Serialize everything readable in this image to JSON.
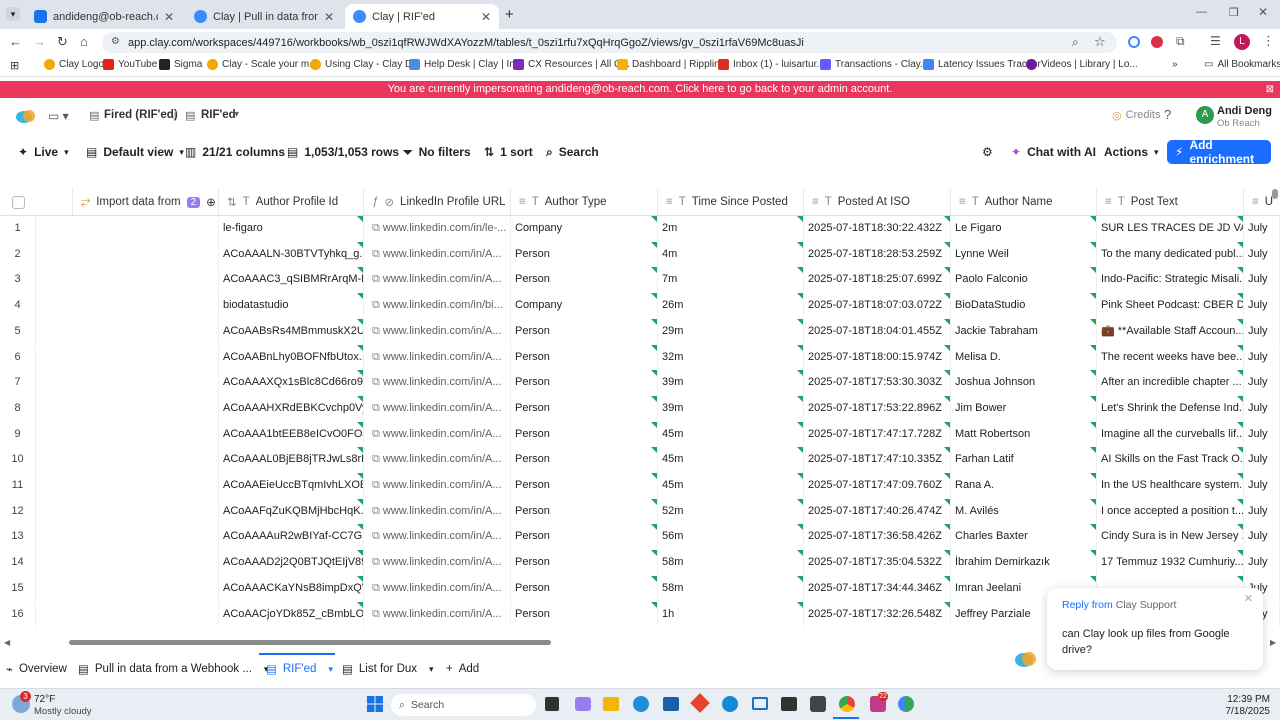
{
  "browser": {
    "tabs": [
      {
        "title": "andideng@ob-reach.com | Inb",
        "color": "#1a73e8"
      },
      {
        "title": "Clay | Pull in data from a Webh",
        "color": "#3d8bfd"
      },
      {
        "title": "Clay | RIF'ed",
        "color": "#3d8bfd"
      }
    ],
    "url": "app.clay.com/workspaces/449716/workbooks/wb_0szi1qfRWJWdXAYozzM/tables/t_0szi1rfu7xQqHrqGgoZ/views/gv_0szi1rfaV69Mc8uasJi",
    "bookmarks": [
      {
        "label": "Clay Logo",
        "color": "#f2a900"
      },
      {
        "label": "YouTube",
        "color": "#e62117"
      },
      {
        "label": "Sigma",
        "color": "#222222"
      },
      {
        "label": "Clay - Scale your m...",
        "color": "#f2a900"
      },
      {
        "label": "Using Clay - Clay D...",
        "color": "#f2a900"
      },
      {
        "label": "Help Desk | Clay | In...",
        "color": "#4a90d9"
      },
      {
        "label": "CX Resources | All Q...",
        "color": "#7b2cbf"
      },
      {
        "label": "Dashboard | Rippling",
        "color": "#f4b400"
      },
      {
        "label": "Inbox (1) - luisartur...",
        "color": "#d93025"
      },
      {
        "label": "Transactions - Clay...",
        "color": "#635bff"
      },
      {
        "label": "Latency Issues Tracker",
        "color": "#4285f4"
      },
      {
        "label": "Videos | Library | Lo...",
        "color": "#6a1b9a"
      }
    ],
    "all_bookmarks": "All Bookmarks",
    "profile_initial": "L"
  },
  "banner": "You are currently impersonating andideng@ob-reach.com. Click here to go back to your admin account.",
  "app": {
    "breadcrumb_folder": "Fired (RIF'ed)",
    "breadcrumb_table": "RIF'ed",
    "credits": "Credits",
    "user_name": "Andi Deng",
    "user_org": "Ob Reach",
    "user_initial": "A"
  },
  "toolbar": {
    "live": "Live",
    "view": "Default view",
    "columns": "21/21 columns",
    "rows": "1,053/1,053 rows",
    "filters": "No filters",
    "sort": "1 sort",
    "search": "Search",
    "chat": "Chat with AI",
    "actions": "Actions",
    "add_enrichment": "Add enrichment"
  },
  "columns": [
    {
      "label": "Import data from",
      "badge": "2"
    },
    {
      "label": "Author Profile Id"
    },
    {
      "label": "LinkedIn Profile URL"
    },
    {
      "label": "Author Type"
    },
    {
      "label": "Time Since Posted"
    },
    {
      "label": "Posted At ISO"
    },
    {
      "label": "Author Name"
    },
    {
      "label": "Post Text"
    },
    {
      "label": "U"
    }
  ],
  "rows": [
    {
      "n": "1",
      "id": "le-figaro",
      "url": "www.linkedin.com/in/le-...",
      "type": "Company",
      "since": "2m",
      "iso": "2025-07-18T18:30:22.432Z",
      "name": "Le Figaro",
      "text": "SUR LES TRACES DE JD VAN...",
      "u": "July"
    },
    {
      "n": "2",
      "id": "ACoAAALN-30BTVTyhkq_g...",
      "url": "www.linkedin.com/in/A...",
      "type": "Person",
      "since": "4m",
      "iso": "2025-07-18T18:28:53.259Z",
      "name": "Lynne Weil",
      "text": "To the many dedicated publ...",
      "u": "July"
    },
    {
      "n": "3",
      "id": "ACoAAAC3_qSIBMRrArqM-H...",
      "url": "www.linkedin.com/in/A...",
      "type": "Person",
      "since": "7m",
      "iso": "2025-07-18T18:25:07.699Z",
      "name": "Paolo Falconio",
      "text": "Indo-Pacific: Strategic Misali...",
      "u": "July"
    },
    {
      "n": "4",
      "id": "biodatastudio",
      "url": "www.linkedin.com/in/bi...",
      "type": "Company",
      "since": "26m",
      "iso": "2025-07-18T18:07:03.072Z",
      "name": "BioDataStudio",
      "text": "Pink Sheet Podcast: CBER Di...",
      "u": "July"
    },
    {
      "n": "5",
      "id": "ACoAABsRs4MBmmuskX2U...",
      "url": "www.linkedin.com/in/A...",
      "type": "Person",
      "since": "29m",
      "iso": "2025-07-18T18:04:01.455Z",
      "name": "Jackie Tabraham",
      "text": "💼 **Available Staff Accoun...",
      "u": "July"
    },
    {
      "n": "6",
      "id": "ACoAABnLhy0BOFNfbUtox...",
      "url": "www.linkedin.com/in/A...",
      "type": "Person",
      "since": "32m",
      "iso": "2025-07-18T18:00:15.974Z",
      "name": "Melisa D.",
      "text": "The recent weeks have bee...",
      "u": "July"
    },
    {
      "n": "7",
      "id": "ACoAAAXQx1sBlc8Cd66ro9...",
      "url": "www.linkedin.com/in/A...",
      "type": "Person",
      "since": "39m",
      "iso": "2025-07-18T17:53:30.303Z",
      "name": "Joshua Johnson",
      "text": "After an incredible chapter ...",
      "u": "July"
    },
    {
      "n": "8",
      "id": "ACoAAAHXRdEBKCvchp0Vy...",
      "url": "www.linkedin.com/in/A...",
      "type": "Person",
      "since": "39m",
      "iso": "2025-07-18T17:53:22.896Z",
      "name": "Jim Bower",
      "text": "Let's Shrink the Defense Ind...",
      "u": "July"
    },
    {
      "n": "9",
      "id": "ACoAAA1btEEB8eICvO0FOJ...",
      "url": "www.linkedin.com/in/A...",
      "type": "Person",
      "since": "45m",
      "iso": "2025-07-18T17:47:17.728Z",
      "name": "Matt Robertson",
      "text": "Imagine all the curveballs lif...",
      "u": "July"
    },
    {
      "n": "10",
      "id": "ACoAAAL0BjEB8jTRJwLs8rD...",
      "url": "www.linkedin.com/in/A...",
      "type": "Person",
      "since": "45m",
      "iso": "2025-07-18T17:47:10.335Z",
      "name": "Farhan Latif",
      "text": "AI Skills on the Fast Track O...",
      "u": "July"
    },
    {
      "n": "11",
      "id": "ACoAAEieUccBTqmIvhLXOB...",
      "url": "www.linkedin.com/in/A...",
      "type": "Person",
      "since": "45m",
      "iso": "2025-07-18T17:47:09.760Z",
      "name": "Rana A.",
      "text": "In the US healthcare system...",
      "u": "July"
    },
    {
      "n": "12",
      "id": "ACoAAFqZuKQBMjHbcHqK...",
      "url": "www.linkedin.com/in/A...",
      "type": "Person",
      "since": "52m",
      "iso": "2025-07-18T17:40:26.474Z",
      "name": "M. Avilés",
      "text": "I once accepted a position t...",
      "u": "July"
    },
    {
      "n": "13",
      "id": "ACoAAAAuR2wBIYaf-CC7G...",
      "url": "www.linkedin.com/in/A...",
      "type": "Person",
      "since": "56m",
      "iso": "2025-07-18T17:36:58.426Z",
      "name": "Charles Baxter",
      "text": "Cindy Sura is in New Jersey ...",
      "u": "July"
    },
    {
      "n": "14",
      "id": "ACoAAAD2j2Q0BTJQtEIjV89p...",
      "url": "www.linkedin.com/in/A...",
      "type": "Person",
      "since": "58m",
      "iso": "2025-07-18T17:35:04.532Z",
      "name": "İbrahim Demirkazık",
      "text": "17 Temmuz 1932 Cumhuriy...",
      "u": "July"
    },
    {
      "n": "15",
      "id": "ACoAAACKaYNsB8impDxQVz...",
      "url": "www.linkedin.com/in/A...",
      "type": "Person",
      "since": "58m",
      "iso": "2025-07-18T17:34:44.346Z",
      "name": "Imran Jeelani",
      "text": "",
      "u": "July"
    },
    {
      "n": "16",
      "id": "ACoAACjoYDk85Z_cBmbLO...",
      "url": "www.linkedin.com/in/A...",
      "type": "Person",
      "since": "1h",
      "iso": "2025-07-18T17:32:26.548Z",
      "name": "Jeffrey Parziale",
      "text": "",
      "u": "July"
    }
  ],
  "bottom_tabs": {
    "overview": "Overview",
    "tab1": "Pull in data from a Webhook ...",
    "tab2": "RIF'ed",
    "tab3": "List for Dux",
    "add": "Add"
  },
  "chat_popup": {
    "reply_from": "Reply from",
    "sender": "Clay Support",
    "message": "can Clay look up files from Google drive?"
  },
  "taskbar": {
    "weather_temp": "72°F",
    "weather_desc": "Mostly cloudy",
    "search": "Search",
    "time": "12:39 PM",
    "date": "7/18/2025",
    "badge": "3",
    "app_badge": "22"
  },
  "colors": {
    "accent": "#1a6dff",
    "banner": "#e8365d",
    "green_flag": "#1fa463"
  }
}
